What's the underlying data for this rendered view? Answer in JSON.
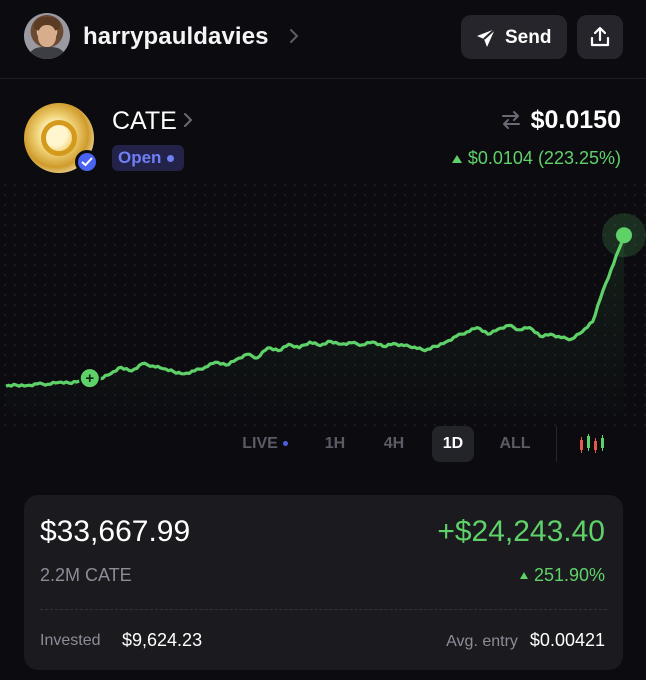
{
  "header": {
    "username": "harrypauldavies",
    "send_label": "Send",
    "icons": {
      "avatar": "user-avatar",
      "chevron": "chevron-right-icon",
      "send": "send-icon",
      "share": "share-icon"
    }
  },
  "token": {
    "name": "CATE",
    "status": "Open",
    "price": "$0.0150",
    "change": "$0.0104 (223.25%)",
    "colors": {
      "positive": "#5fd169",
      "status": "#6f7ff6",
      "verified": "#4a63f1"
    }
  },
  "chart_data": {
    "type": "line",
    "series": [
      {
        "values": [
          0.00455,
          0.00462,
          0.00458,
          0.0047,
          0.00468,
          0.0048,
          0.00476,
          0.0049,
          0.0051,
          0.00505,
          0.0054,
          0.00585,
          0.0056,
          0.0061,
          0.00595,
          0.00575,
          0.00555,
          0.0054,
          0.0056,
          0.00585,
          0.0062,
          0.006,
          0.0064,
          0.00675,
          0.0065,
          0.0072,
          0.007,
          0.00745,
          0.0072,
          0.0076,
          0.00735,
          0.00765,
          0.00745,
          0.00755,
          0.0074,
          0.0076,
          0.0073,
          0.0075,
          0.00735,
          0.00725,
          0.007,
          0.0073,
          0.0076,
          0.008,
          0.0083,
          0.0086,
          0.00815,
          0.0085,
          0.00875,
          0.00845,
          0.0086,
          0.008,
          0.00815,
          0.0079,
          0.0078,
          0.0083,
          0.009,
          0.0112,
          0.013,
          0.015
        ]
      }
    ],
    "entry_marker": {
      "index": 8,
      "label": "+"
    }
  },
  "timeframes": [
    {
      "label": "LIVE",
      "live": true
    },
    {
      "label": "1H"
    },
    {
      "label": "4H"
    },
    {
      "label": "1D",
      "active": true
    },
    {
      "label": "ALL"
    }
  ],
  "position": {
    "value": "$33,667.99",
    "pnl": "+$24,243.40",
    "quantity": "2.2M CATE",
    "pnl_percent": "251.90%",
    "invested_label": "Invested",
    "invested_value": "$9,624.23",
    "avg_entry_label": "Avg. entry",
    "avg_entry_value": "$0.00421"
  }
}
